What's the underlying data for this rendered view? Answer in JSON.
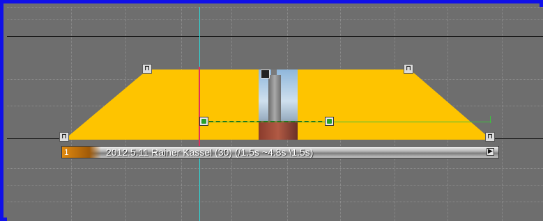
{
  "colors": {
    "frame_border": "#1010e8",
    "timeline_bg": "#6e6e6e",
    "envelope_fill": "#fec400",
    "playhead": "#2fd6d6",
    "cursor": "#e0305a",
    "keyframe_line": "#3cc23c"
  },
  "clip": {
    "index": "1",
    "title": "2012.5.11 Rainer Kassel (30) (/1.5s ~4.8s \\1.5s)",
    "end_glyph": "▶"
  },
  "handles": {
    "glyph": "⊓"
  },
  "icons": [
    "fade-handle-icon",
    "keyframe-icon",
    "clip-end-arrow-icon"
  ]
}
